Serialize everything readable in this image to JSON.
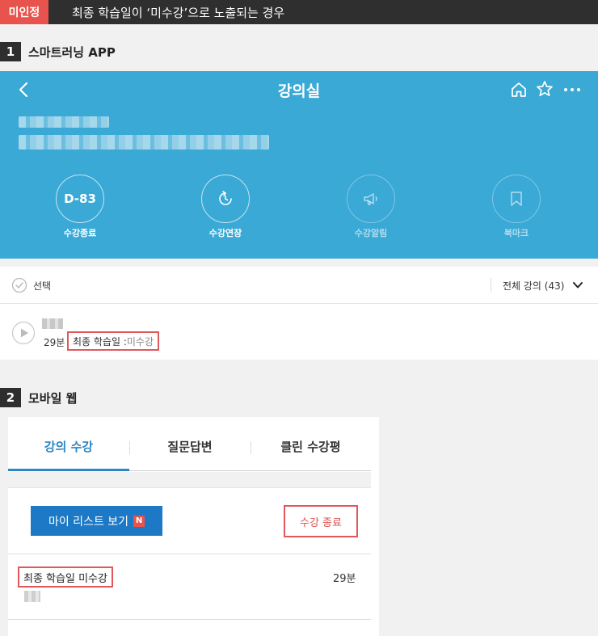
{
  "banner": {
    "badge": "미인정",
    "title": "최종 학습일이 ‘미수강’으로 노출되는 경우"
  },
  "section1": {
    "number": "1",
    "title": "스마트러닝 APP"
  },
  "app": {
    "title": "강의실",
    "icons": {
      "back": "chevron-left-icon",
      "home": "home-icon",
      "favorite": "star-icon",
      "more": "more-icon"
    },
    "actions": [
      {
        "label": "수강종료",
        "value": "D-83"
      },
      {
        "label": "수강연장",
        "icon": "clock-rotate-icon"
      },
      {
        "label": "수강알림",
        "icon": "megaphone-icon"
      },
      {
        "label": "북마크",
        "icon": "bookmark-icon"
      }
    ],
    "select_label": "선택",
    "filter_label": "전체 강의 (43)",
    "lecture": {
      "duration": "29분",
      "last_study_label": "최종 학습일 : ",
      "last_study_value": "미수강"
    }
  },
  "section2": {
    "number": "2",
    "title": "모바일 웹"
  },
  "web": {
    "tabs": [
      "강의 수강",
      "질문답변",
      "클린 수강평"
    ],
    "mylist_button": "마이 리스트 보기",
    "new_badge": "N",
    "end_button": "수강 종료",
    "last_study": "최종 학습일 미수강",
    "duration": "29분"
  },
  "colors": {
    "accent_blue": "#3aa9d6",
    "highlight_red": "#e0585a",
    "button_blue": "#1d79c5"
  }
}
